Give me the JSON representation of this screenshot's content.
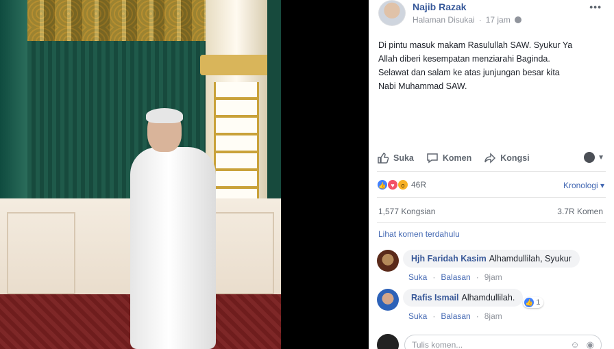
{
  "post": {
    "author": "Najib Razak",
    "page_label": "Halaman Disukai",
    "dot": "·",
    "time": "17 jam",
    "more_label": "•••",
    "text_lines": [
      "Di pintu masuk makam Rasulullah SAW. Syukur Ya",
      "Allah diberi kesempatan menziarahi Baginda.",
      "Selawat dan salam ke atas junjungan besar kita",
      "Nabi Muhammad SAW."
    ]
  },
  "actions": {
    "like": "Suka",
    "comment": "Komen",
    "share": "Kongsi",
    "audience_icon": "globe-icon"
  },
  "stats": {
    "reactions_count": "46R",
    "sort_label": "Kronologi ▾",
    "shares": "1,577 Kongsian",
    "comments": "3.7R Komen"
  },
  "comments_section": {
    "view_previous": "Lihat komen terdahulu",
    "items": [
      {
        "name": "Hjh Faridah Kasim",
        "text": "Alhamdullilah, Syukur",
        "like": "Suka",
        "reply": "Balasan",
        "time": "9jam"
      },
      {
        "name": "Rafis Ismail",
        "text": "Alhamdullilah.",
        "like": "Suka",
        "reply": "Balasan",
        "time": "8jam",
        "reaction_count": "1"
      }
    ],
    "compose_placeholder": "Tulis komen..."
  },
  "colors": {
    "link": "#365899",
    "muted": "#90949c",
    "like_blue": "#4080ff",
    "love_red": "#f25268",
    "wow_yellow": "#f7b125"
  }
}
